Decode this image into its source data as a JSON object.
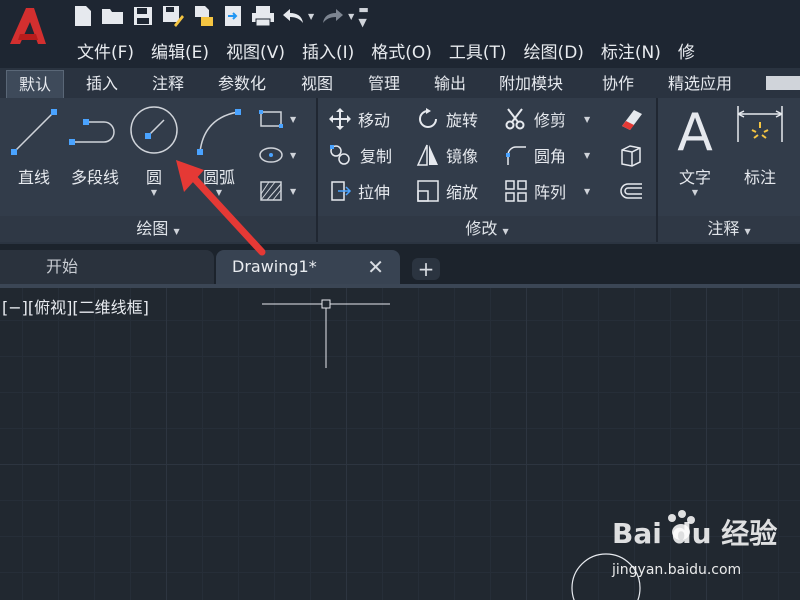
{
  "app": {
    "logo_letter": "A"
  },
  "menu": [
    "文件(F)",
    "编辑(E)",
    "视图(V)",
    "插入(I)",
    "格式(O)",
    "工具(T)",
    "绘图(D)",
    "标注(N)",
    "修"
  ],
  "ribbon_tabs": [
    "默认",
    "插入",
    "注释",
    "参数化",
    "视图",
    "管理",
    "输出",
    "附加模块",
    "协作",
    "精选应用"
  ],
  "active_ribbon_tab": "默认",
  "draw_panel": {
    "title": "绘图",
    "tools": [
      "直线",
      "多段线",
      "圆",
      "圆弧"
    ]
  },
  "modify_panel": {
    "title": "修改",
    "tools": [
      "移动",
      "旋转",
      "修剪",
      "复制",
      "镜像",
      "圆角",
      "拉伸",
      "缩放",
      "阵列"
    ]
  },
  "annotation_panel": {
    "title": "注释",
    "tools": [
      "文字",
      "标注"
    ]
  },
  "file_tabs": [
    "开始",
    "Drawing1*"
  ],
  "active_file_tab": "Drawing1*",
  "viewport_label": "[−][俯视][二维线框]",
  "watermark": {
    "brand": "Bai du 经验",
    "url": "jingyan.baidu.com"
  },
  "colors": {
    "accent": "#c62828",
    "arrow": "#e53935",
    "icon_blue": "#4aa3ff",
    "ribbon_bg": "#323c4a"
  }
}
